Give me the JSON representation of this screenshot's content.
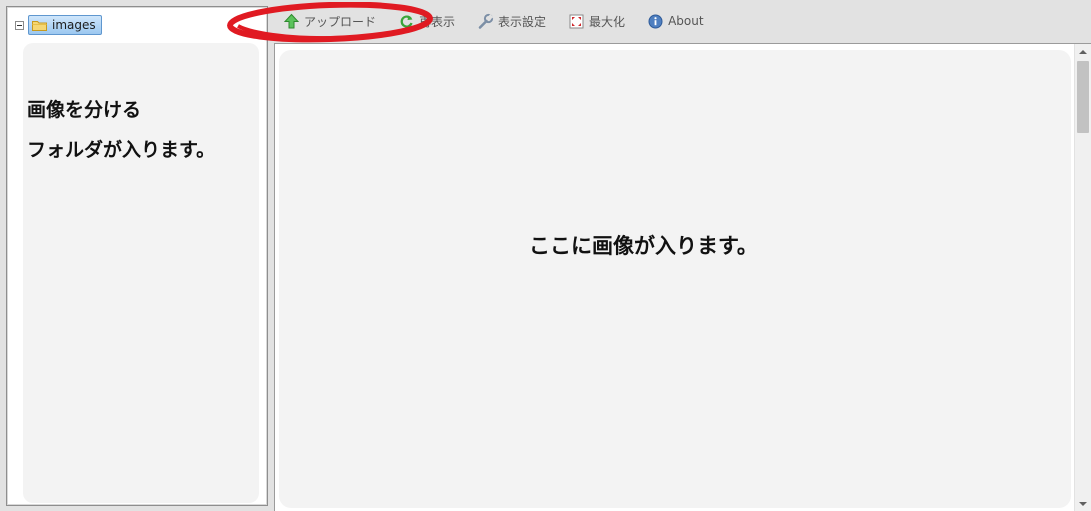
{
  "tree": {
    "root_label": "images"
  },
  "left_panel": {
    "note_line1": "画像を分ける",
    "note_line2": "フォルダが入ります。"
  },
  "toolbar": {
    "items": [
      {
        "label": "アップロード",
        "icon": "upload-arrow-icon"
      },
      {
        "label": "再表示",
        "icon": "refresh-icon"
      },
      {
        "label": "表示設定",
        "icon": "wrench-icon"
      },
      {
        "label": "最大化",
        "icon": "maximize-icon"
      },
      {
        "label": "About",
        "icon": "info-icon"
      }
    ]
  },
  "main": {
    "placeholder_text": "ここに画像が入ります。"
  },
  "colors": {
    "annotation": "#e01a22",
    "selection": "#9cc8f0",
    "upload_arrow": "#3aa53a"
  }
}
